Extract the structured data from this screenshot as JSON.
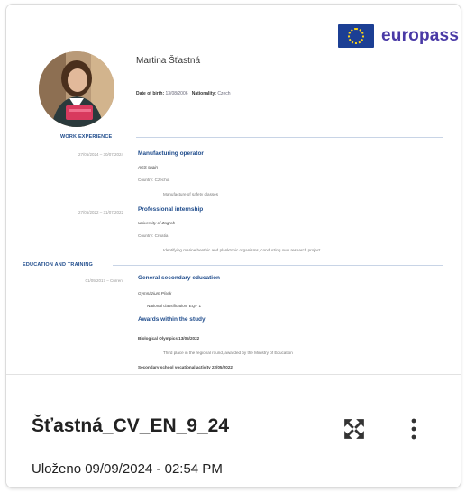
{
  "europass": {
    "label": "europass"
  },
  "cv": {
    "name": "Martina Šťastná",
    "meta": {
      "dob_label": "Date of birth:",
      "dob_value": "13/08/2006",
      "nat_label": "Nationality:",
      "nat_value": "Czech"
    },
    "work": {
      "title": "WORK EXPERIENCE",
      "items": [
        {
          "date": "27/05/2024 – 30/07/2024",
          "title": "Manufacturing operator",
          "lines": [
            "AGS spain",
            "Country: Czechia",
            "Manufacture of safety glasses"
          ]
        },
        {
          "date": "27/05/2022 – 31/07/2022",
          "title": "Professional internship",
          "lines": [
            "University of Zagreb",
            "Country: Croatia",
            "Identifying marine benthic and planktonic organisms, conducting own research project"
          ]
        }
      ]
    },
    "education": {
      "title": "EDUCATION AND TRAINING",
      "date": "01/09/2017 – Current",
      "title_item": "General secondary education",
      "lines": [
        "Gymnázium Písek",
        "National classification: EQF 1"
      ],
      "awards_title": "Awards within the study",
      "awards": [
        "Biological Olympics 13/05/2022",
        "Third place in the regional round, awarded by the Ministry of Education",
        "Secondary school vocational activity 22/05/2022"
      ]
    }
  },
  "file": {
    "name": "Šťastná_CV_EN_9_24",
    "saved": "Uloženo 09/09/2024 - 02:54 PM"
  },
  "icons": {
    "expand": "expand-arrows-icon",
    "more": "more-vertical-icon"
  },
  "colors": {
    "accent": "#1f4c8c",
    "eu_blue": "#1c3f94",
    "eu_text": "#4a3aa6"
  }
}
